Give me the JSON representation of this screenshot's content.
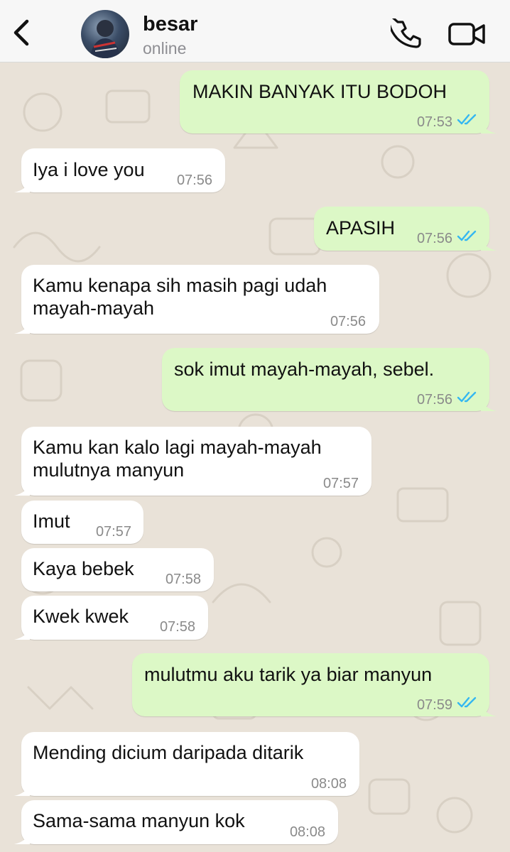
{
  "header": {
    "contact_name": "besar",
    "contact_status": "online"
  },
  "colors": {
    "incoming_bubble": "#ffffff",
    "outgoing_bubble": "#dcf8c6",
    "wallpaper": "#e9e2d8",
    "read_ticks": "#34b7f1"
  },
  "icons": {
    "back": "chevron-left-icon",
    "call": "phone-icon",
    "video": "video-camera-icon",
    "read_status": "double-check-icon"
  },
  "messages": [
    {
      "direction": "out",
      "text": "MAKIN BANYAK ITU BODOH",
      "time": "07:53",
      "read": true
    },
    {
      "direction": "in",
      "text": "Iya i love you",
      "time": "07:56"
    },
    {
      "direction": "out",
      "text": "APASIH",
      "time": "07:56",
      "read": true
    },
    {
      "direction": "in",
      "text": "Kamu kenapa sih masih pagi udah\nmayah-mayah",
      "time": "07:56"
    },
    {
      "direction": "out",
      "text": "sok imut mayah-mayah, sebel.",
      "time": "07:56",
      "read": true
    },
    {
      "direction": "in",
      "text": "Kamu kan kalo lagi mayah-mayah\nmulutnya manyun",
      "time": "07:57"
    },
    {
      "direction": "in",
      "text": "Imut",
      "time": "07:57"
    },
    {
      "direction": "in",
      "text": "Kaya bebek",
      "time": "07:58"
    },
    {
      "direction": "in",
      "text": "Kwek kwek",
      "time": "07:58"
    },
    {
      "direction": "out",
      "text": "mulutmu aku tarik ya biar manyun",
      "time": "07:59",
      "read": true
    },
    {
      "direction": "in",
      "text": "Mending dicium daripada ditarik",
      "time": "08:08"
    },
    {
      "direction": "in",
      "text": "Sama-sama manyun kok",
      "time": "08:08"
    }
  ]
}
